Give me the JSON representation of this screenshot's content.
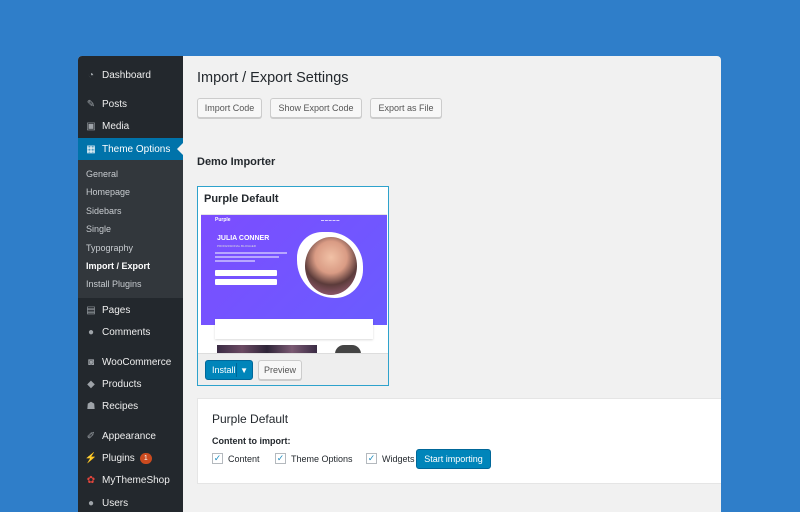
{
  "sidebar": {
    "top_items": [
      {
        "label": "Dashboard",
        "icon": "dashboard-icon"
      },
      {
        "label": "Posts",
        "icon": "pin-icon"
      },
      {
        "label": "Media",
        "icon": "media-icon"
      },
      {
        "label": "Theme Options",
        "icon": "theme-options-icon"
      }
    ],
    "submenu": [
      "General",
      "Homepage",
      "Sidebars",
      "Single",
      "Typography",
      "Import / Export",
      "Install Plugins"
    ],
    "bottom_items": [
      {
        "label": "Pages",
        "icon": "pages-icon"
      },
      {
        "label": "Comments",
        "icon": "comments-icon"
      },
      {
        "label": "WooCommerce",
        "icon": "woocommerce-icon"
      },
      {
        "label": "Products",
        "icon": "products-icon"
      },
      {
        "label": "Recipes",
        "icon": "recipes-icon"
      },
      {
        "label": "Appearance",
        "icon": "appearance-icon"
      },
      {
        "label": "Plugins",
        "icon": "plugins-icon"
      },
      {
        "label": "MyThemeShop",
        "icon": "mythemeshop-icon"
      },
      {
        "label": "Users",
        "icon": "users-icon"
      }
    ],
    "plugins_badge": "1"
  },
  "main": {
    "title": "Import / Export Settings",
    "buttons": {
      "import_code": "Import Code",
      "show_export": "Show Export Code",
      "export_file": "Export as File"
    },
    "demo_section_title": "Demo Importer",
    "demo_card": {
      "title": "Purple Default",
      "install": "Install",
      "preview": "Preview",
      "preview_logo": "Purple",
      "preview_name": "JULIA CONNER",
      "preview_subtitle": "PROFESSIONAL BLOGGER"
    },
    "import_panel": {
      "title": "Purple Default",
      "label": "Content to import:",
      "options": [
        {
          "label": "Content",
          "checked": true
        },
        {
          "label": "Theme Options",
          "checked": true
        },
        {
          "label": "Widgets",
          "checked": true
        }
      ],
      "start_button": "Start importing"
    }
  },
  "colors": {
    "background": "#2f7ec9",
    "sidebar": "#23282d",
    "accent": "#0073aa",
    "badge": "#ca4a1f",
    "preview_purple": "#7c4dff"
  }
}
